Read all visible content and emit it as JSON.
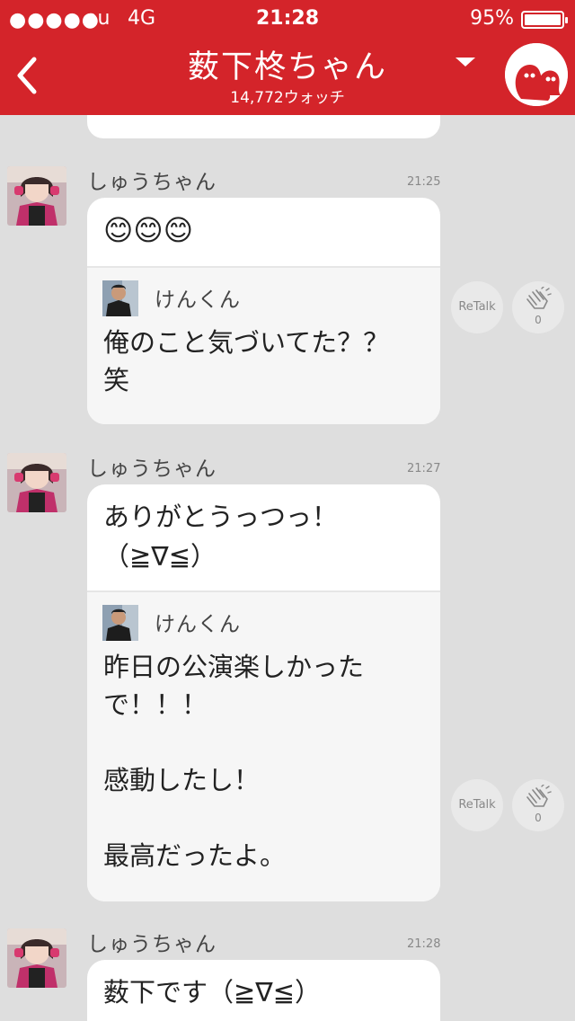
{
  "status_bar": {
    "signal": "●●●●●",
    "carrier": "au",
    "network": "4G",
    "time": "21:28",
    "battery_pct": "95%"
  },
  "header": {
    "title": "薮下柊ちゃん",
    "watch_count": "14,772ウォッチ",
    "accent_color": "#d4242a"
  },
  "actions": {
    "retalk_label": "ReTalk"
  },
  "messages": [
    {
      "sender": "しゅうちゃん",
      "time": "21:25",
      "text": "😊😊😊",
      "quote": {
        "name": "けんくん",
        "text": "俺のこと気づいてた？？\n笑"
      },
      "clap_count": "0"
    },
    {
      "sender": "しゅうちゃん",
      "time": "21:27",
      "text": "ありがとうっつっ！\n（≧∇≦）",
      "quote": {
        "name": "けんくん",
        "text": "昨日の公演楽しかった\nで！！！\n\n感動したし！\n\n最高だったよ。"
      },
      "clap_count": "0"
    },
    {
      "sender": "しゅうちゃん",
      "time": "21:28",
      "text": "薮下です（≧∇≦）"
    }
  ]
}
